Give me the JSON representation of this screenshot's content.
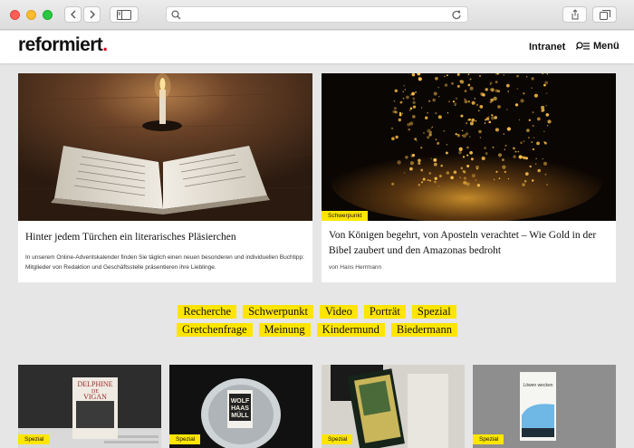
{
  "header": {
    "logo": "reformiert",
    "logo_dot": ".",
    "nav_intranet": "Intranet",
    "nav_menu": "Menü"
  },
  "featured": [
    {
      "title": "Hinter jedem Türchen ein literarisches Pläsierchen",
      "teaser": "In unserem Online-Adventskalender finden Sie täglich einen neuen besonderen und individuellen Buchtipp: Mitglieder von Redaktion und Geschäftsstelle präsentieren ihre Lieblinge."
    },
    {
      "tag": "Schwerpunkt",
      "title": "Von Königen begehrt, von Aposteln verachtet – Wie Gold in der Bibel zaubert und den Amazonas bedroht",
      "author": "von Hans Herrmann"
    }
  ],
  "categories": {
    "row1": [
      "Recherche",
      "Schwerpunkt",
      "Video",
      "Porträt",
      "Spezial"
    ],
    "row2": [
      "Gretchenfrage",
      "Meinung",
      "Kindermund",
      "Biedermann"
    ]
  },
  "thumbs": [
    {
      "tag": "Spezial",
      "book_line1": "DELPHINE",
      "book_line2": "DE",
      "book_line3": "VIGAN"
    },
    {
      "tag": "Spezial",
      "book_line1": "WOLF",
      "book_line2": "HAAS",
      "book_line3": "MÜLL"
    },
    {
      "tag": "Spezial"
    },
    {
      "tag": "Spezial",
      "book_line1": "Löwen wecken"
    }
  ],
  "colors": {
    "accent_yellow": "#ffe500",
    "logo_red": "#e2001a"
  }
}
